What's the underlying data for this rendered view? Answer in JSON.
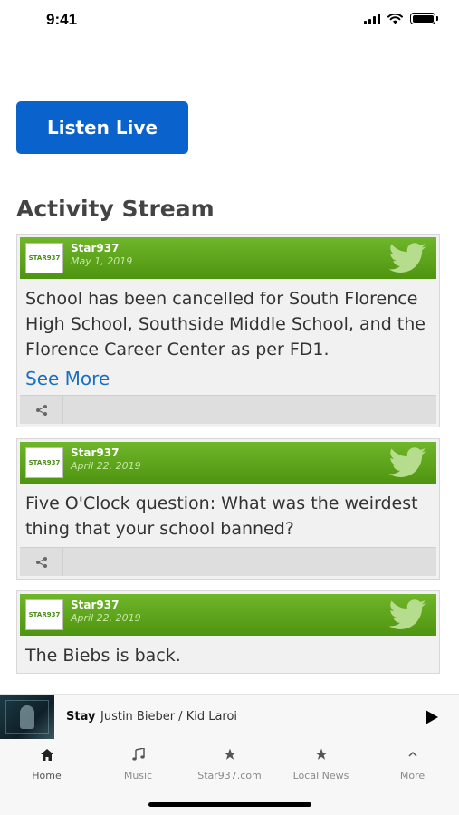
{
  "status_bar": {
    "time": "9:41"
  },
  "listen_live": {
    "label": "Listen Live"
  },
  "activity": {
    "title": "Activity Stream",
    "items": [
      {
        "author": "Star937",
        "date": "May 1, 2019",
        "text": "School has been cancelled for South Florence High School, Southside Middle School, and the Florence Career Center as per FD1.",
        "more": "See More"
      },
      {
        "author": "Star937",
        "date": "April 22, 2019",
        "text": "Five O'Clock question: What was the weirdest thing that your school banned?"
      },
      {
        "author": "Star937",
        "date": "April 22, 2019",
        "text": "The Biebs is back."
      }
    ]
  },
  "now_playing": {
    "title": "Stay",
    "artist": "Justin Bieber / Kid Laroi"
  },
  "tabs": [
    {
      "label": "Home",
      "icon": "home-icon"
    },
    {
      "label": "Music",
      "icon": "music-note-icon"
    },
    {
      "label": "Star937.com",
      "icon": "star-icon"
    },
    {
      "label": "Local News",
      "icon": "star-icon"
    },
    {
      "label": "More",
      "icon": "chevron-up-icon"
    }
  ],
  "colors": {
    "accent": "#0a63cc",
    "card_header": "#5ea31c",
    "link": "#1a6fc4"
  }
}
